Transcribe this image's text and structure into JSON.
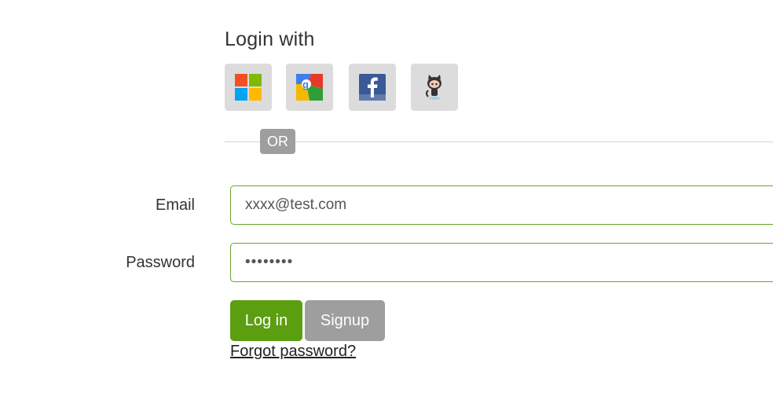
{
  "heading": "Login with",
  "social": [
    {
      "icon": "microsoft-icon",
      "name": "Microsoft"
    },
    {
      "icon": "google-icon",
      "name": "Google"
    },
    {
      "icon": "facebook-icon",
      "name": "Facebook"
    },
    {
      "icon": "github-icon",
      "name": "GitHub"
    }
  ],
  "divider": {
    "label": "OR"
  },
  "form": {
    "email_label": "Email",
    "email_value": "xxxx@test.com",
    "password_label": "Password",
    "password_value": "••••••••"
  },
  "buttons": {
    "login_label": "Log in",
    "signup_label": "Signup"
  },
  "forgot_password_label": "Forgot password?",
  "colors": {
    "accent_green": "#5b9e0f",
    "input_border": "#6aa628",
    "secondary_gray": "#9e9e9e",
    "social_bg": "#dcdcdc"
  }
}
